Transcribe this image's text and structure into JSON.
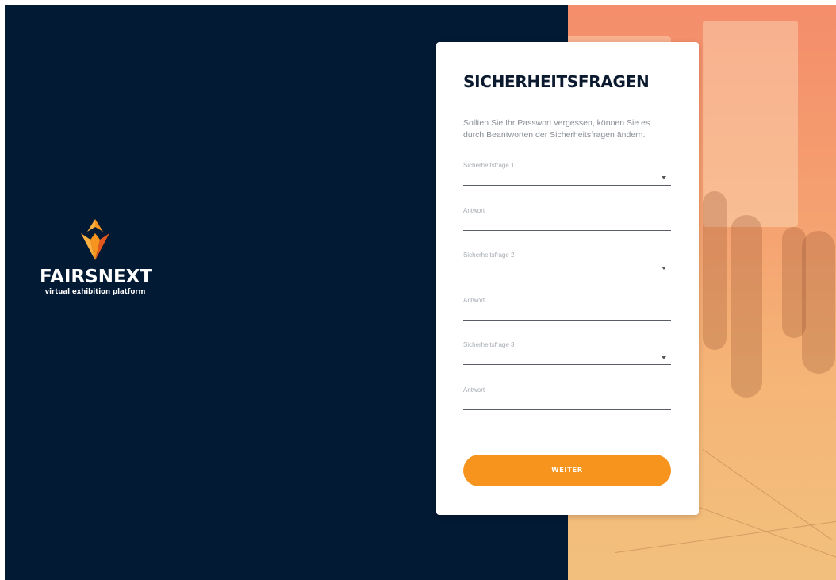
{
  "brand": {
    "name": "FAIRSNEXT",
    "tagline": "virtual exhibition platform",
    "colors": {
      "navy": "#031a34",
      "orange": "#f7941d",
      "orange_dark": "#e2571e"
    }
  },
  "form": {
    "title": "SICHERHEITSFRAGEN",
    "description": "Sollten Sie Ihr Passwort vergessen, können Sie es durch Beantworten der Sicherheitsfragen ändern.",
    "fields": [
      {
        "label": "Sicherheitsfrage 1",
        "type": "select",
        "value": ""
      },
      {
        "label": "Antwort",
        "type": "text",
        "value": ""
      },
      {
        "label": "Sicherheitsfrage 2",
        "type": "select",
        "value": ""
      },
      {
        "label": "Antwort",
        "type": "text",
        "value": ""
      },
      {
        "label": "Sicherheitsfrage 3",
        "type": "select",
        "value": ""
      },
      {
        "label": "Antwort",
        "type": "text",
        "value": ""
      }
    ],
    "submit_label": "WEITER"
  },
  "icons": {
    "select_caret": "chevron-down-icon",
    "logo": "fairsnext-flame-logo"
  }
}
